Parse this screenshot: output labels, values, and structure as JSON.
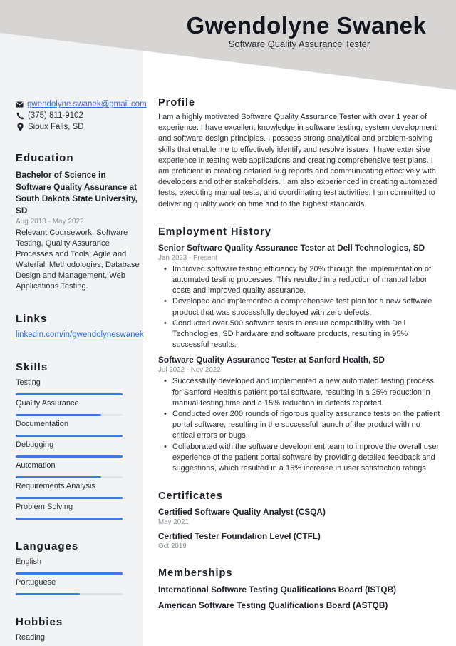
{
  "header": {
    "name": "Gwendolyne Swanek",
    "job_title": "Software Quality Assurance Tester",
    "band_color": "#d7d5d3"
  },
  "contact": {
    "email": "gwendolyne.swanek@gmail.com",
    "phone": "(375) 811-9102",
    "location": "Sioux Falls, SD",
    "icons": [
      "envelope-icon",
      "phone-icon",
      "map-pin-icon"
    ]
  },
  "education": {
    "heading": "Education",
    "degree": "Bachelor of Science in Software Quality Assurance at South Dakota State University, SD",
    "dates": "Aug 2018 - May 2022",
    "description": "Relevant Coursework: Software Testing, Quality Assurance Processes and Tools, Agile and Waterfall Methodologies, Database Design and Management, Web Applications Testing."
  },
  "links": {
    "heading": "Links",
    "items": [
      "linkedin.com/in/gwendolyneswanek"
    ]
  },
  "skills": {
    "heading": "Skills",
    "items": [
      {
        "label": "Testing",
        "level": 1.0
      },
      {
        "label": "Quality Assurance",
        "level": 0.8
      },
      {
        "label": "Documentation",
        "level": 1.0
      },
      {
        "label": "Debugging",
        "level": 1.0
      },
      {
        "label": "Automation",
        "level": 0.8
      },
      {
        "label": "Requirements Analysis",
        "level": 1.0
      },
      {
        "label": "Problem Solving",
        "level": 1.0
      }
    ]
  },
  "languages": {
    "heading": "Languages",
    "items": [
      {
        "label": "English",
        "level": 1.0
      },
      {
        "label": "Portuguese",
        "level": 0.6
      }
    ]
  },
  "hobbies": {
    "heading": "Hobbies",
    "items": [
      "Reading"
    ]
  },
  "profile": {
    "heading": "Profile",
    "text": "I am a highly motivated Software Quality Assurance Tester with over 1 year of experience. I have excellent knowledge in software testing, system development and software design principles. I possess strong analytical and problem-solving skills that enable me to effectively identify and resolve issues. I have extensive experience in testing web applications and creating comprehensive test plans. I am proficient in creating detailed bug reports and communicating effectively with developers and other stakeholders. I am also experienced in creating automated tests, executing manual tests, and coordinating test activities. I am committed to delivering quality work on time and to the highest standards."
  },
  "employment": {
    "heading": "Employment History",
    "jobs": [
      {
        "title": "Senior Software Quality Assurance Tester at Dell Technologies, SD",
        "dates": "Jan 2023 - Present",
        "bullets": [
          "Improved software testing efficiency by 20% through the implementation of automated testing processes. This resulted in a reduction of manual labor costs and improved quality assurance.",
          "Developed and implemented a comprehensive test plan for a new software product that was successfully deployed with zero defects.",
          "Conducted over 500 software tests to ensure compatibility with Dell Technologies, SD hardware and software products, resulting in 95% successful results."
        ]
      },
      {
        "title": "Software Quality Assurance Tester at Sanford Health, SD",
        "dates": "Jul 2022 - Nov 2022",
        "bullets": [
          "Successfully developed and implemented a new automated testing process for Sanford Health's patient portal software, resulting in a 25% reduction in manual testing time and a 15% reduction in defects reported.",
          "Conducted over 200 rounds of rigorous quality assurance tests on the patient portal software, resulting in the successful launch of the product with no critical errors or bugs.",
          "Collaborated with the software development team to improve the overall user experience of the patient portal software by providing detailed feedback and suggestions, which resulted in a 15% increase in user satisfaction ratings."
        ]
      }
    ]
  },
  "certificates": {
    "heading": "Certificates",
    "items": [
      {
        "name": "Certified Software Quality Analyst (CSQA)",
        "date": "May 2021"
      },
      {
        "name": "Certified Tester Foundation Level (CTFL)",
        "date": "Oct 2019"
      }
    ]
  },
  "memberships": {
    "heading": "Memberships",
    "items": [
      "International Software Testing Qualifications Board (ISTQB)",
      "American Software Testing Qualifications Board (ASTQB)"
    ]
  },
  "colors": {
    "accent": "#3a7be6",
    "link": "#2f6fe0",
    "sidebar_bg": "#f2f3f5",
    "muted_text": "#8a8e96"
  }
}
